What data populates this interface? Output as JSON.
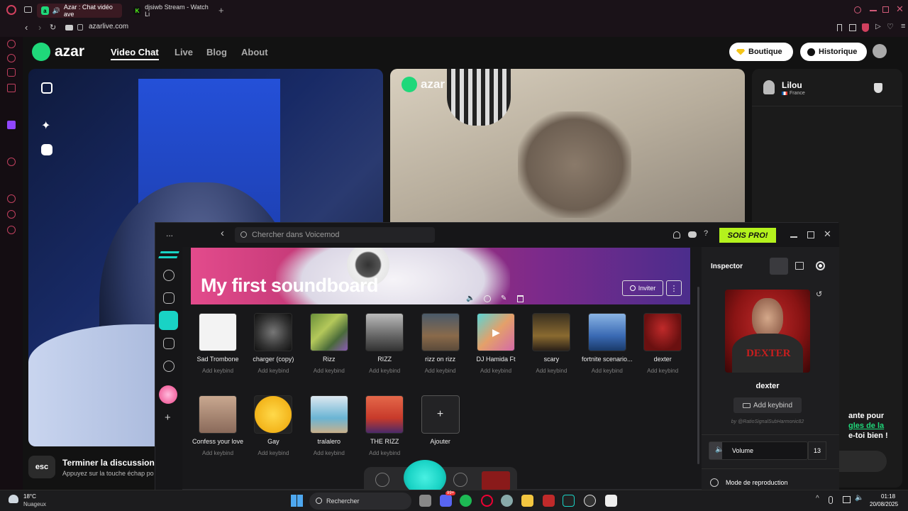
{
  "browser": {
    "tabs": [
      {
        "title": "Azar : Chat vidéo ave"
      },
      {
        "title": "djsiwb Stream - Watch Li"
      }
    ],
    "new_tab_symbol": "+",
    "url": "azarlive.com",
    "icons": [
      "opera-icon",
      "back-icon",
      "forward-icon",
      "reload-icon",
      "camera-icon",
      "lock-icon",
      "search-icon",
      "minimize-icon",
      "maximize-icon",
      "close-icon",
      "bookmark-icon",
      "snapshot-icon",
      "shield-icon",
      "play-icon",
      "heart-icon",
      "menu-icon"
    ]
  },
  "azar": {
    "logo": "azar",
    "nav": [
      "Video Chat",
      "Live",
      "Blog",
      "About"
    ],
    "boutique_label": "Boutique",
    "historique_label": "Historique",
    "partner_name": "Lilou",
    "partner_country": "France",
    "end_key": "esc",
    "end_title": "Terminer la discussion v",
    "end_sub": "Appuyez sur la touche échap po",
    "right_text_line1": "ante pour",
    "right_text_line2": "gles de la",
    "right_text_line3": "e-toi bien !",
    "video_logo": "azar"
  },
  "voicemod": {
    "menu_dots": "...",
    "back_symbol": "‹",
    "search_placeholder": "Chercher dans Voicemod",
    "help_symbol": "?",
    "pro_label": "SOIS PRO!",
    "banner_title": "My first soundboard",
    "invite_label": "Inviter",
    "add_symbol": "+",
    "sounds_row1": [
      {
        "name": "Sad Trombone",
        "keybind": "Add keybind"
      },
      {
        "name": "charger (copy)",
        "keybind": "Add keybind"
      },
      {
        "name": "Rizz",
        "keybind": "Add keybind"
      },
      {
        "name": "RIZZ",
        "keybind": "Add keybind"
      },
      {
        "name": "rizz on rizz",
        "keybind": "Add keybind"
      },
      {
        "name": "DJ Hamida Ft",
        "keybind": "Add keybind"
      },
      {
        "name": "scary",
        "keybind": "Add keybind"
      },
      {
        "name": "fortnite scenario...",
        "keybind": "Add keybind"
      },
      {
        "name": "dexter",
        "keybind": "Add keybind"
      }
    ],
    "sounds_row2": [
      {
        "name": "Confess your love",
        "keybind": "Add keybind"
      },
      {
        "name": "Gay",
        "keybind": "Add keybind"
      },
      {
        "name": "tralalero",
        "keybind": "Add keybind"
      },
      {
        "name": "THE RIZZ",
        "keybind": "Add keybind"
      },
      {
        "name": "Ajouter",
        "keybind": ""
      }
    ],
    "inspector": {
      "title": "Inspector",
      "sound_name": "dexter",
      "cover_text": "DEXTER",
      "add_keybind": "Add keybind",
      "author": "by @RatioSignalSubHarmonic82",
      "volume_label": "Volume",
      "volume_value": "13",
      "mode_label": "Mode de reproduction"
    }
  },
  "taskbar": {
    "weather_temp": "18°C",
    "weather_desc": "Nuageux",
    "search_label": "Rechercher",
    "time": "01:18",
    "date": "20/08/2025",
    "notification_badge": "99+"
  },
  "colors": {
    "azar_green": "#1fd87a",
    "vm_teal": "#19d3c5",
    "pro_green": "#b4f21d",
    "opera_red": "#d0405e",
    "banner_pink": "#e34b8c"
  }
}
